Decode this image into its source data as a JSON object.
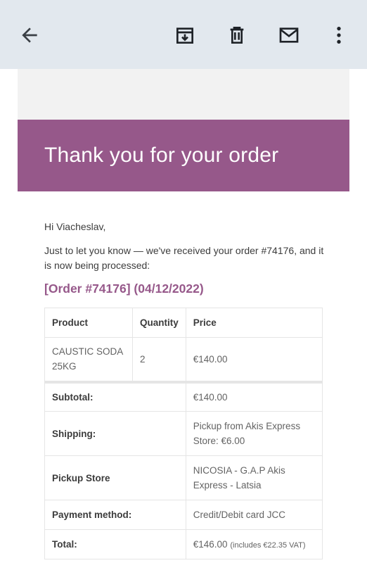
{
  "toolbar": {
    "back_icon": "arrow-left-icon",
    "archive_icon": "archive-icon",
    "delete_icon": "trash-icon",
    "mark_icon": "envelope-icon",
    "more_icon": "more-vertical-icon"
  },
  "colors": {
    "brand": "#96588a",
    "appbar": "#e2e8ee"
  },
  "email": {
    "banner_title": "Thank you for your order",
    "greeting": "Hi Viacheslav,",
    "intro": "Just to let you know — we've received your order #74176, and it is now being processed:",
    "order_heading": "[Order #74176] (04/12/2022)",
    "table": {
      "headers": {
        "product": "Product",
        "quantity": "Quantity",
        "price": "Price"
      },
      "items": [
        {
          "product": "CAUSTIC SODA 25KG",
          "quantity": "2",
          "price": "€140.00"
        }
      ],
      "totals": {
        "subtotal_label": "Subtotal:",
        "subtotal_value": "€140.00",
        "shipping_label": "Shipping:",
        "shipping_value": "Pickup from Akis Express Store: €6.00",
        "store_label": "Pickup Store",
        "store_value": "NICOSIA - G.A.P Akis Express - Latsia",
        "payment_label": "Payment method:",
        "payment_value": "Credit/Debit card JCC",
        "total_label": "Total:",
        "total_value": "€146.00",
        "total_vat": "(includes €22.35 VAT)"
      }
    }
  }
}
